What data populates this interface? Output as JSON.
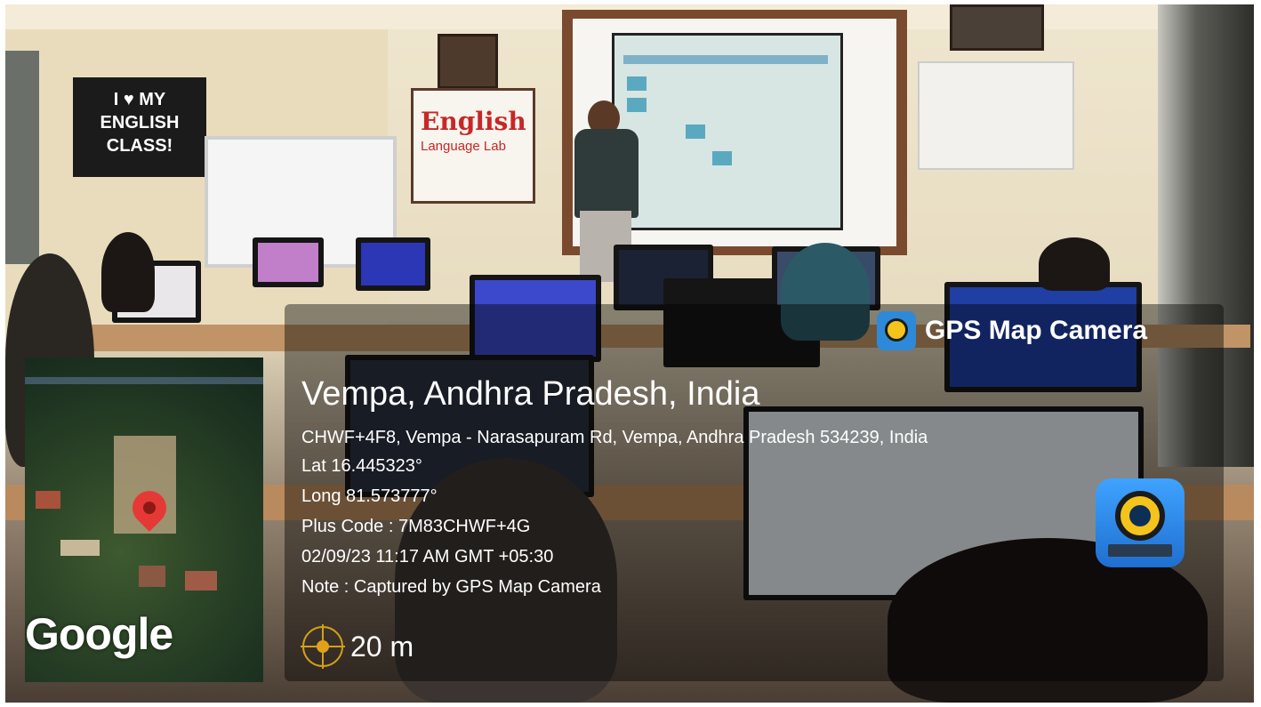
{
  "photo": {
    "poster_left_text": "I ♥ MY ENGLISH CLASS!",
    "poster_center_title": "English",
    "poster_center_subtitle": "Language Lab"
  },
  "brand": {
    "name": "GPS Map Camera",
    "icon": "gps-map-camera-logo-icon"
  },
  "map": {
    "provider_label": "Google",
    "scale_label": "20 m",
    "scale_icon": "target-crosshair-icon",
    "pin_icon": "map-pin-icon"
  },
  "location": {
    "title": "Vempa, Andhra Pradesh, India",
    "address": "CHWF+4F8, Vempa - Narasapuram Rd, Vempa, Andhra Pradesh 534239, India",
    "lat": "Lat 16.445323°",
    "long": "Long 81.573777°",
    "plus_code": "Plus Code : 7M83CHWF+4G",
    "datetime": "02/09/23 11:17 AM GMT +05:30",
    "note": "Note : Captured by GPS Map Camera"
  },
  "colors": {
    "overlay": "#000000",
    "accent_gold": "#d4a017",
    "pin_red": "#e53935"
  }
}
